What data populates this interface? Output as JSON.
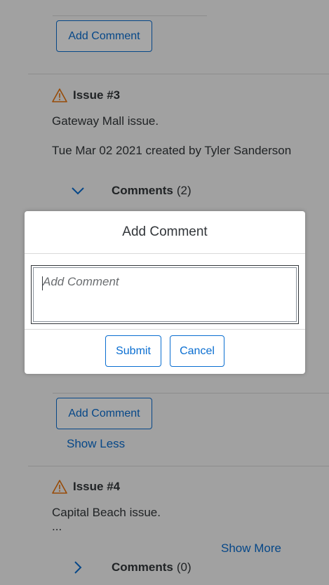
{
  "issue_2": {
    "add_comment_label": "Add Comment"
  },
  "issue_3": {
    "title": "Issue #3",
    "description": "Gateway Mall issue.",
    "meta": "Tue Mar 02 2021 created by Tyler Sanderson",
    "comments_label": "Comments",
    "comments_count": "(2)",
    "add_comment_label": "Add Comment",
    "show_less_label": "Show Less"
  },
  "issue_4": {
    "title": "Issue #4",
    "description": "Capital Beach issue.",
    "ellipsis": "...",
    "show_more_label": "Show More",
    "comments_label": "Comments",
    "comments_count": "(0)"
  },
  "dialog": {
    "title": "Add Comment",
    "textarea_placeholder": "Add Comment",
    "submit_label": "Submit",
    "cancel_label": "Cancel"
  },
  "colors": {
    "accent": "#0a6ed1",
    "warning": "#e9730c",
    "text": "#32363a"
  }
}
